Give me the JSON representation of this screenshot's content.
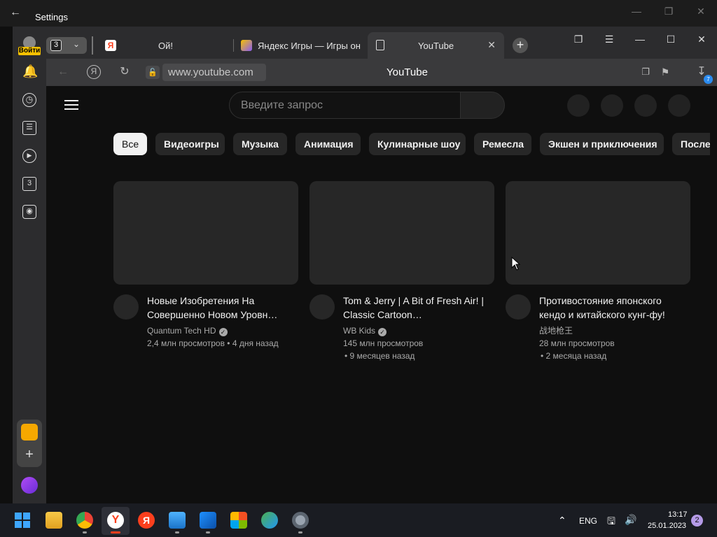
{
  "settings_window": {
    "title": "Settings",
    "back_icon": "arrow-left-icon"
  },
  "browser": {
    "profile": {
      "login_label": "Войти"
    },
    "tab_count": "3",
    "tabs": [
      {
        "label": "Ой!",
        "icon": "yandex-icon"
      },
      {
        "label": "Яндекс Игры — Игры он",
        "icon": "gamepad-icon"
      },
      {
        "label": "YouTube",
        "icon": "document-icon",
        "active": true
      }
    ],
    "address_bar": {
      "url": "www.youtube.com",
      "page_title": "YouTube",
      "download_badge": "7"
    },
    "rail": {
      "items": [
        "bell-icon",
        "history-icon",
        "collections-icon",
        "play-icon",
        "number-3-icon",
        "screenshot-icon"
      ],
      "number_label": "3"
    }
  },
  "youtube": {
    "search": {
      "placeholder": "Введите запрос"
    },
    "chips": [
      "Все",
      "Видеоигры",
      "Музыка",
      "Анимация",
      "Кулинарные шоу",
      "Ремесла",
      "Экшен и приключения",
      "После"
    ],
    "videos": [
      {
        "title": "Новые Изобретения На Совершенно Новом Уровн…",
        "channel": "Quantum Tech HD",
        "verified": true,
        "views": "2,4 млн просмотров",
        "age": "• 4 дня назад"
      },
      {
        "title": "Tom & Jerry | A Bit of Fresh Air! | Classic Cartoon…",
        "channel": "WB Kids",
        "verified": true,
        "views": "145 млн просмотров",
        "age": "• 9 месяцев назад"
      },
      {
        "title": "Противостояние японского кендо и китайского кунг-фу!",
        "channel": "战地枪王",
        "verified": false,
        "views": "28 млн просмотров",
        "age": "• 2 месяца назад"
      }
    ]
  },
  "taskbar": {
    "lang": "ENG",
    "time": "13:17",
    "date": "25.01.2023",
    "notifications": "2",
    "colors": {
      "yandex_red": "#fc3f1d",
      "yt_bg": "#0f0f0f",
      "chip_bg": "#272727"
    }
  }
}
